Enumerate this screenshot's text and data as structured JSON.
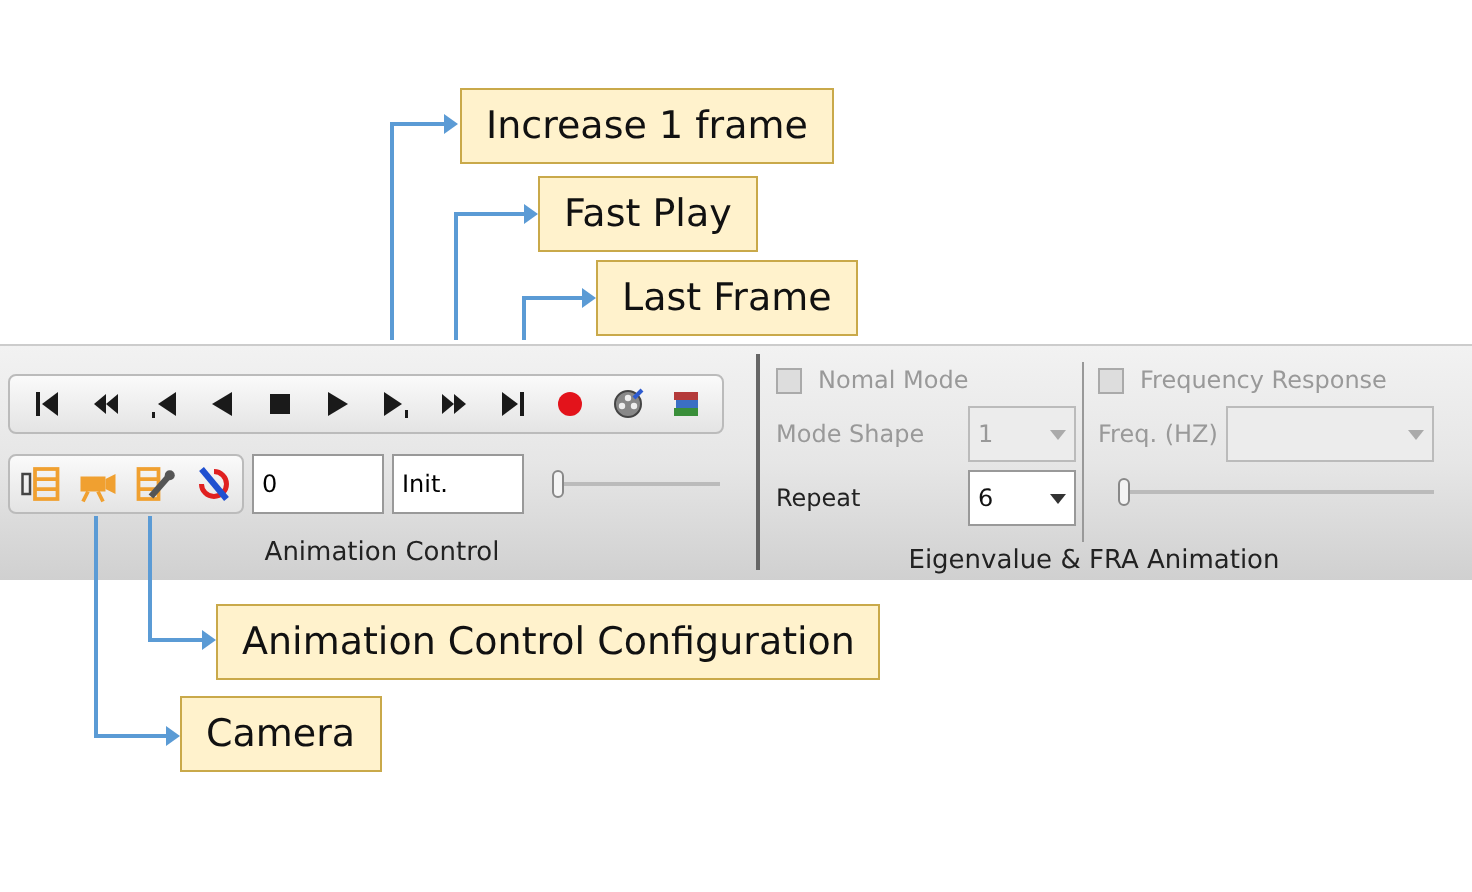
{
  "callouts": [
    {
      "text": "Increase 1 frame"
    },
    {
      "text": "Fast Play"
    },
    {
      "text": "Last Frame"
    },
    {
      "text": "Animation Control Configuration"
    },
    {
      "text": "Camera"
    }
  ],
  "animation_control": {
    "frame_field": {
      "value": "0"
    },
    "state_field": {
      "value": "Init."
    },
    "slider": {
      "level": 0
    },
    "group_label": "Animation Control"
  },
  "eigenvalue": {
    "normal_mode": {
      "label": "Nomal Mode",
      "checked": false,
      "disabled": true
    },
    "mode_shape": {
      "label": "Mode Shape",
      "value": "1",
      "disabled": true
    },
    "repeat": {
      "label": "Repeat",
      "value": "6",
      "disabled": false
    },
    "frequency_response": {
      "label": "Frequency Response",
      "checked": false,
      "disabled": true
    },
    "freq": {
      "label": "Freq. (HZ)",
      "disabled": true
    },
    "slider": {
      "level": 0
    },
    "group_label": "Eigenvalue & FRA Animation"
  }
}
